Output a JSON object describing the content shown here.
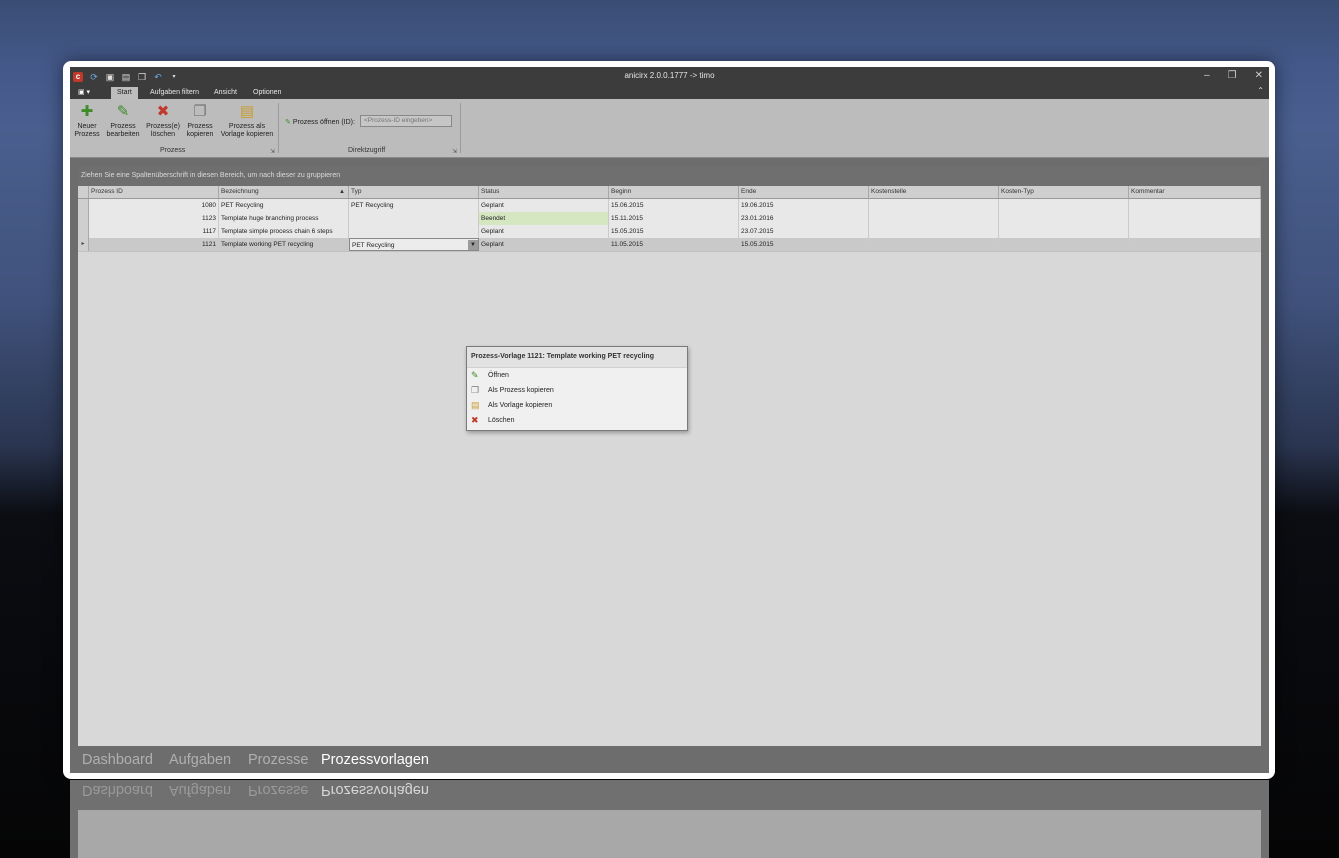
{
  "window": {
    "title": "anicirx 2.0.0.1777 -> timo"
  },
  "quick_access": {
    "icons": [
      "app-logo-icon",
      "refresh-icon",
      "save-icon",
      "document-icon",
      "copy-icon",
      "undo-icon",
      "dropdown-icon"
    ],
    "app_logo_letter": "c"
  },
  "window_controls": {
    "minimize": "–",
    "restore": "❐",
    "close": "✕"
  },
  "ribbon": {
    "tabs": [
      {
        "label": "Start",
        "active": true
      },
      {
        "label": "Aufgaben filtern",
        "active": false
      },
      {
        "label": "Ansicht",
        "active": false
      },
      {
        "label": "Optionen",
        "active": false
      }
    ],
    "group_prozess": {
      "label": "Prozess",
      "buttons": [
        {
          "line1": "Neuer",
          "line2": "Prozess",
          "icon": "new-process-icon"
        },
        {
          "line1": "Prozess",
          "line2": "bearbeiten",
          "icon": "edit-process-icon"
        },
        {
          "line1": "Prozess(e)",
          "line2": "löschen",
          "icon": "delete-process-icon"
        },
        {
          "line1": "Prozess",
          "line2": "kopieren",
          "icon": "copy-process-icon"
        },
        {
          "line1": "Prozess als",
          "line2": "Vorlage kopieren",
          "icon": "copy-template-icon"
        }
      ]
    },
    "group_direkt": {
      "label": "Direktzugriff",
      "open_label": "Prozess öffnen (ID):",
      "input_placeholder": "<Prozess-ID eingeben>",
      "input_value": ""
    }
  },
  "grid": {
    "group_hint": "Ziehen Sie eine Spaltenüberschrift in diesen Bereich, um nach dieser zu gruppieren",
    "columns": [
      "Prozess ID",
      "Bezeichnung",
      "Typ",
      "Status",
      "Beginn",
      "Ende",
      "Kostenstelle",
      "Kosten-Typ",
      "Kommentar"
    ],
    "sort_column": "Bezeichnung",
    "sort_direction": "ascending",
    "rows": [
      {
        "id": "1080",
        "bezeichnung": "PET Recycling",
        "typ": "PET Recycling",
        "status": "Geplant",
        "beginn": "15.06.2015",
        "ende": "19.06.2015",
        "kostenstelle": "",
        "kosten_typ": "",
        "kommentar": ""
      },
      {
        "id": "1123",
        "bezeichnung": "Template huge branching process",
        "typ": "",
        "status": "Beendet",
        "beginn": "15.11.2015",
        "ende": "23.01.2016",
        "kostenstelle": "",
        "kosten_typ": "",
        "kommentar": ""
      },
      {
        "id": "1117",
        "bezeichnung": "Template simple process chain 6 steps",
        "typ": "",
        "status": "Geplant",
        "beginn": "15.05.2015",
        "ende": "23.07.2015",
        "kostenstelle": "",
        "kosten_typ": "",
        "kommentar": ""
      },
      {
        "id": "1121",
        "bezeichnung": "Template working PET recycling",
        "typ": "PET Recycling",
        "status": "Geplant",
        "beginn": "11.05.2015",
        "ende": "15.05.2015",
        "kostenstelle": "",
        "kosten_typ": "",
        "kommentar": ""
      }
    ],
    "focused_row_marker": "▸",
    "status_colors": {
      "Beendet": "#d5e7c0"
    }
  },
  "context_menu": {
    "title": "Prozess-Vorlage 1121: Template working PET recycling",
    "items": [
      {
        "label": "Öffnen",
        "icon": "open-icon"
      },
      {
        "label": "Als Prozess kopieren",
        "icon": "copy-as-process-icon"
      },
      {
        "label": "Als Vorlage kopieren",
        "icon": "copy-as-template-icon"
      },
      {
        "label": "Löschen",
        "icon": "delete-icon"
      }
    ]
  },
  "bottom_nav": {
    "items": [
      {
        "label": "Dashboard",
        "active": false
      },
      {
        "label": "Aufgaben",
        "active": false
      },
      {
        "label": "Prozesse",
        "active": false
      },
      {
        "label": "Prozessvorlagen",
        "active": true
      }
    ]
  }
}
